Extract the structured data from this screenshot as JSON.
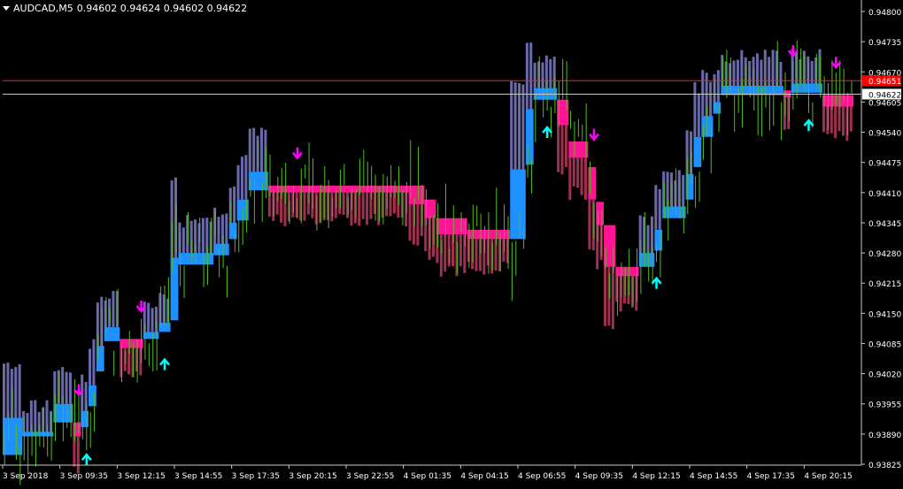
{
  "window": {
    "symbol_label": "AUDCAD,M5",
    "ohlc_label": "0.94602 0.94624 0.94602 0.94622"
  },
  "colors": {
    "background": "#000000",
    "axis": "#c8c8c8",
    "tick_text": "#ffffff",
    "candle": "#4fbf1f",
    "up_block": "#1e90ff",
    "down_block": "#ff1493",
    "up_stripe": "#6a6aaa",
    "down_stripe": "#a03050",
    "up_arrow": "#00ffff",
    "down_arrow": "#ff00ff",
    "ask_line": "#ff2020",
    "bid_line": "#c8c8c8",
    "ask_badge": "#ff0000",
    "bid_badge": "#ffffff"
  },
  "chart_data": {
    "type": "candlestick",
    "title": "",
    "ylim": [
      0.93825,
      0.948
    ],
    "y_ticks": [
      "0.94800",
      "0.94735",
      "0.94670",
      "0.94605",
      "0.94540",
      "0.94475",
      "0.94410",
      "0.94345",
      "0.94280",
      "0.94215",
      "0.94150",
      "0.94085",
      "0.94020",
      "0.93955",
      "0.93890",
      "0.93825"
    ],
    "x_ticks": [
      "3 Sep 2018",
      "3 Sep 09:35",
      "3 Sep 12:15",
      "3 Sep 14:55",
      "3 Sep 17:35",
      "3 Sep 20:15",
      "3 Sep 22:55",
      "4 Sep 01:35",
      "4 Sep 04:15",
      "4 Sep 06:55",
      "4 Sep 09:35",
      "4 Sep 12:15",
      "4 Sep 14:55",
      "4 Sep 17:35",
      "4 Sep 20:15"
    ],
    "ask_price": 0.94651,
    "ask_label": "0.94651",
    "bid_price": 0.94622,
    "bid_label": "0.94622",
    "trend_blocks": [
      {
        "from": 0,
        "to": 5,
        "hi": 0.93925,
        "lo": 0.93845,
        "dir": "up"
      },
      {
        "from": 5,
        "to": 13,
        "hi": 0.93895,
        "lo": 0.93885,
        "dir": "up"
      },
      {
        "from": 13,
        "to": 18,
        "hi": 0.93955,
        "lo": 0.93915,
        "dir": "up"
      },
      {
        "from": 18,
        "to": 20,
        "hi": 0.93915,
        "lo": 0.93885,
        "dir": "down"
      },
      {
        "from": 20,
        "to": 22,
        "hi": 0.9394,
        "lo": 0.93905,
        "dir": "up"
      },
      {
        "from": 22,
        "to": 24,
        "hi": 0.93995,
        "lo": 0.9395,
        "dir": "up"
      },
      {
        "from": 24,
        "to": 26,
        "hi": 0.9408,
        "lo": 0.94025,
        "dir": "up"
      },
      {
        "from": 26,
        "to": 30,
        "hi": 0.9412,
        "lo": 0.9409,
        "dir": "up"
      },
      {
        "from": 30,
        "to": 36,
        "hi": 0.94095,
        "lo": 0.94075,
        "dir": "down"
      },
      {
        "from": 36,
        "to": 40,
        "hi": 0.9411,
        "lo": 0.94095,
        "dir": "up"
      },
      {
        "from": 40,
        "to": 43,
        "hi": 0.9413,
        "lo": 0.9411,
        "dir": "up"
      },
      {
        "from": 43,
        "to": 45,
        "hi": 0.9427,
        "lo": 0.94135,
        "dir": "up"
      },
      {
        "from": 45,
        "to": 54,
        "hi": 0.9428,
        "lo": 0.94255,
        "dir": "up"
      },
      {
        "from": 54,
        "to": 58,
        "hi": 0.943,
        "lo": 0.94275,
        "dir": "up"
      },
      {
        "from": 58,
        "to": 60,
        "hi": 0.94345,
        "lo": 0.9431,
        "dir": "up"
      },
      {
        "from": 60,
        "to": 63,
        "hi": 0.94395,
        "lo": 0.9435,
        "dir": "up"
      },
      {
        "from": 63,
        "to": 68,
        "hi": 0.94455,
        "lo": 0.94415,
        "dir": "up"
      },
      {
        "from": 68,
        "to": 104,
        "hi": 0.94425,
        "lo": 0.9441,
        "dir": "down"
      },
      {
        "from": 104,
        "to": 108,
        "hi": 0.94425,
        "lo": 0.94385,
        "dir": "down"
      },
      {
        "from": 108,
        "to": 111,
        "hi": 0.94395,
        "lo": 0.94355,
        "dir": "down"
      },
      {
        "from": 111,
        "to": 119,
        "hi": 0.94355,
        "lo": 0.9432,
        "dir": "down"
      },
      {
        "from": 119,
        "to": 130,
        "hi": 0.9433,
        "lo": 0.9431,
        "dir": "down"
      },
      {
        "from": 130,
        "to": 134,
        "hi": 0.9446,
        "lo": 0.9431,
        "dir": "up"
      },
      {
        "from": 134,
        "to": 136,
        "hi": 0.9459,
        "lo": 0.9447,
        "dir": "up"
      },
      {
        "from": 136,
        "to": 142,
        "hi": 0.94635,
        "lo": 0.9461,
        "dir": "up"
      },
      {
        "from": 142,
        "to": 145,
        "hi": 0.9461,
        "lo": 0.94555,
        "dir": "down"
      },
      {
        "from": 145,
        "to": 150,
        "hi": 0.9452,
        "lo": 0.94485,
        "dir": "down"
      },
      {
        "from": 150,
        "to": 152,
        "hi": 0.94465,
        "lo": 0.94395,
        "dir": "down"
      },
      {
        "from": 152,
        "to": 154,
        "hi": 0.9439,
        "lo": 0.9434,
        "dir": "down"
      },
      {
        "from": 154,
        "to": 157,
        "hi": 0.9434,
        "lo": 0.9425,
        "dir": "down"
      },
      {
        "from": 157,
        "to": 163,
        "hi": 0.9425,
        "lo": 0.9423,
        "dir": "down"
      },
      {
        "from": 163,
        "to": 167,
        "hi": 0.9428,
        "lo": 0.9425,
        "dir": "up"
      },
      {
        "from": 167,
        "to": 169,
        "hi": 0.9433,
        "lo": 0.94285,
        "dir": "up"
      },
      {
        "from": 169,
        "to": 175,
        "hi": 0.9438,
        "lo": 0.94355,
        "dir": "up"
      },
      {
        "from": 175,
        "to": 177,
        "hi": 0.9445,
        "lo": 0.94395,
        "dir": "up"
      },
      {
        "from": 177,
        "to": 179,
        "hi": 0.9453,
        "lo": 0.94465,
        "dir": "up"
      },
      {
        "from": 179,
        "to": 182,
        "hi": 0.94575,
        "lo": 0.9453,
        "dir": "up"
      },
      {
        "from": 182,
        "to": 184,
        "hi": 0.94605,
        "lo": 0.9458,
        "dir": "up"
      },
      {
        "from": 184,
        "to": 200,
        "hi": 0.9464,
        "lo": 0.9462,
        "dir": "up"
      },
      {
        "from": 200,
        "to": 202,
        "hi": 0.9463,
        "lo": 0.94615,
        "dir": "down"
      },
      {
        "from": 202,
        "to": 210,
        "hi": 0.94645,
        "lo": 0.94625,
        "dir": "up"
      },
      {
        "from": 210,
        "to": 218,
        "hi": 0.9462,
        "lo": 0.94595,
        "dir": "down"
      }
    ],
    "signals": [
      {
        "bar": 19,
        "dir": "down"
      },
      {
        "bar": 21,
        "dir": "up"
      },
      {
        "bar": 35,
        "dir": "down"
      },
      {
        "bar": 41,
        "dir": "up"
      },
      {
        "bar": 75,
        "dir": "down"
      },
      {
        "bar": 139,
        "dir": "up"
      },
      {
        "bar": 151,
        "dir": "down"
      },
      {
        "bar": 167,
        "dir": "up"
      },
      {
        "bar": 202,
        "dir": "down"
      },
      {
        "bar": 206,
        "dir": "up"
      },
      {
        "bar": 213,
        "dir": "down"
      }
    ]
  }
}
